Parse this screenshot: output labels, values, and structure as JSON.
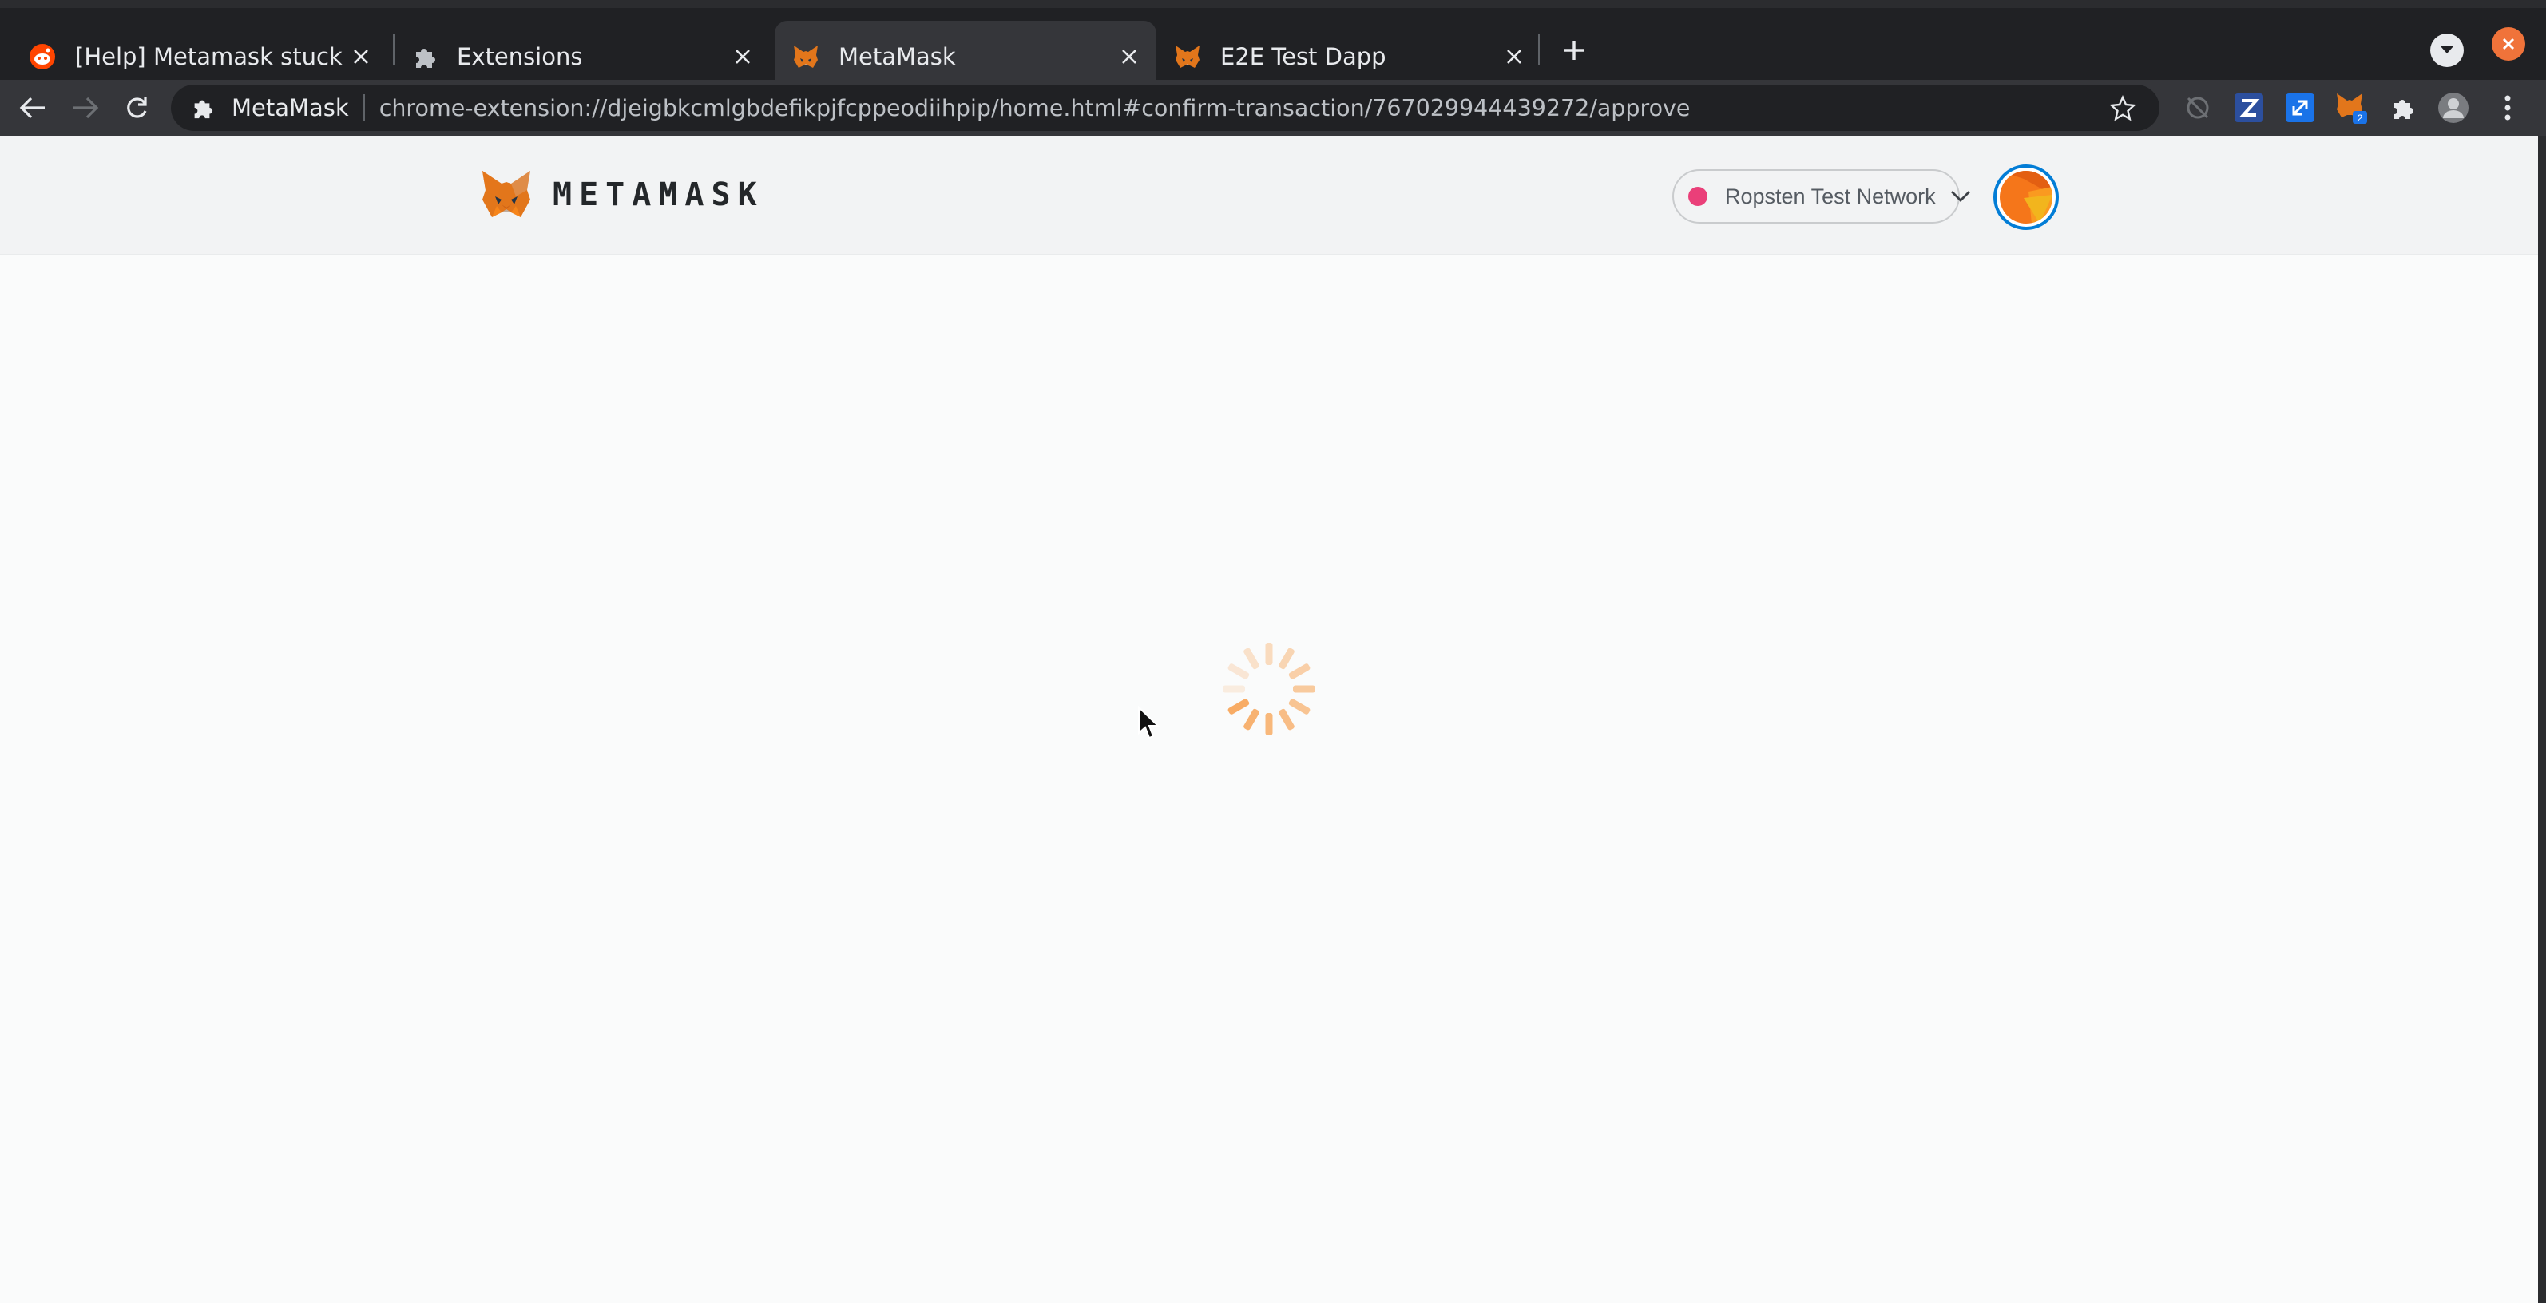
{
  "browser": {
    "tabs": [
      {
        "title": "[Help] Metamask stuck at loa",
        "favicon": "reddit-icon",
        "active": false
      },
      {
        "title": "Extensions",
        "favicon": "puzzle-icon",
        "active": false
      },
      {
        "title": "MetaMask",
        "favicon": "metamask-fox-icon",
        "active": true
      },
      {
        "title": "E2E Test Dapp",
        "favicon": "metamask-fox-icon",
        "active": false
      }
    ],
    "omnibox": {
      "site_name": "MetaMask",
      "url": "chrome-extension://djeigbkcmlgbdefikpjfcppeodiihpip/home.html#confirm-transaction/767029944439272/approve"
    },
    "extension_badge": "2"
  },
  "metamask": {
    "wordmark": "METAMASK",
    "network": {
      "name": "Ropsten Test Network",
      "color": "#e91e63"
    },
    "accent_color": "#f6851b",
    "avatar_ring_color": "#037dd6",
    "status": "loading"
  }
}
